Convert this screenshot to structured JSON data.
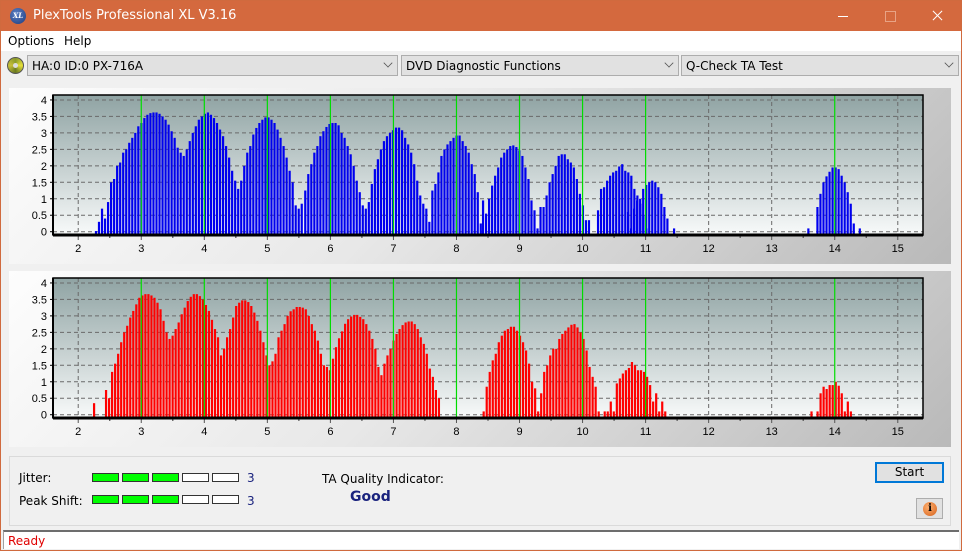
{
  "window": {
    "title": "PlexTools Professional XL V3.16",
    "icon": "xl-logo-icon"
  },
  "menu": {
    "items": [
      "Options",
      "Help"
    ]
  },
  "toolbar": {
    "drive": "HA:0 ID:0  PX-716A",
    "function_group": "DVD Diagnostic Functions",
    "test": "Q-Check TA Test"
  },
  "results": {
    "jitter_label": "Jitter:",
    "jitter_value": 3,
    "jitter_scale_max": 5,
    "peak_shift_label": "Peak Shift:",
    "peak_shift_value": 3,
    "peak_shift_scale_max": 5,
    "ta_label": "TA Quality Indicator:",
    "ta_value": "Good",
    "start_label": "Start",
    "info_label": "i"
  },
  "status": {
    "text": "Ready"
  },
  "colors": {
    "accent_title": "#d4693e",
    "series_top": "#0000ee",
    "series_bottom": "#ff0000",
    "marker_lines": "#00dd00",
    "meter_on": "#00ff00",
    "quality_text": "#1a237e",
    "status_text": "#e00000"
  },
  "chart_data": [
    {
      "type": "bar",
      "name": "land-ta-distribution",
      "xlim": [
        1.6,
        15.4
      ],
      "ylim": [
        -0.1,
        4.15
      ],
      "xticks": [
        2,
        3,
        4,
        5,
        6,
        7,
        8,
        9,
        10,
        11,
        12,
        13,
        14,
        15
      ],
      "yticks": [
        0,
        0.5,
        1,
        1.5,
        2,
        2.5,
        3,
        3.5,
        4
      ],
      "ytick_labels": [
        "0",
        "0.5",
        "1",
        "1.5",
        "2",
        "2.5",
        "3",
        "3.5",
        "4"
      ],
      "marker_lines_x": [
        3,
        4,
        5,
        6,
        7,
        8,
        9,
        10,
        11,
        14
      ],
      "grid": true,
      "color": "#0000ee",
      "peaks": [
        {
          "start": 2.28,
          "step": 0.048,
          "values": [
            0.02,
            0.3,
            0.7,
            0.4,
            0.9,
            1.5,
            1.6,
            2.0,
            2.1,
            2.4,
            2.5,
            2.7,
            2.85,
            3.0,
            3.2,
            3.3,
            3.45,
            3.55,
            3.6,
            3.62,
            3.62,
            3.58,
            3.5,
            3.4,
            3.25,
            3.05,
            2.85,
            2.55,
            2.4,
            2.3,
            2.5,
            2.75,
            3.0,
            3.2,
            3.4,
            3.5,
            3.58,
            3.62,
            3.55,
            3.45,
            3.3,
            3.1,
            2.9,
            2.6,
            2.25,
            1.85,
            1.55,
            1.3,
            1.55,
            2.0,
            2.4,
            2.6,
            2.95,
            3.15,
            3.3,
            3.4,
            3.47,
            3.47,
            3.4,
            3.3,
            3.1,
            2.85,
            2.6,
            2.25,
            1.85,
            1.5,
            0.8,
            0.7,
            0.85
          ]
        },
        {
          "start": 5.6,
          "step": 0.048,
          "values": [
            1.25,
            1.75,
            2.05,
            2.4,
            2.6,
            2.9,
            3.05,
            3.18,
            3.27,
            3.3,
            3.3,
            3.23,
            3.0,
            2.85,
            2.6,
            2.35,
            2.0,
            1.55,
            1.2,
            0.8,
            0.7,
            0.9,
            1.45,
            1.9,
            2.2,
            2.5,
            2.75,
            2.9,
            3.0,
            3.08,
            3.16,
            3.16,
            3.08,
            2.85,
            2.65,
            2.4,
            2.05,
            1.55,
            1.1,
            0.85,
            0.7,
            0.3,
            1.25,
            1.45,
            1.8,
            2.3,
            2.5,
            2.65,
            2.75,
            2.85,
            2.92,
            2.92,
            2.75,
            2.6,
            2.4,
            2.05,
            1.75,
            1.2,
            0.25
          ]
        },
        {
          "start": 8.42,
          "step": 0.048,
          "values": [
            0.95,
            0.55,
            1.0,
            1.4,
            1.7,
            1.95,
            2.25,
            2.4,
            2.5,
            2.6,
            2.62,
            2.57,
            2.47,
            2.3,
            1.95,
            1.6,
            0.95,
            0.65,
            0.1,
            0.75,
            0.75,
            1.1,
            1.5,
            1.75,
            2.0,
            2.3,
            2.35,
            2.35,
            2.2,
            2.1,
            1.95,
            1.6,
            1.15,
            0.8,
            0.35,
            0.35,
            0.0,
            0.0,
            0.65,
            1.3,
            1.35,
            1.55,
            1.7,
            1.8,
            1.85,
            1.98,
            2.05,
            1.85,
            1.8,
            1.7,
            1.3,
            1.1,
            0.85,
            0.5,
            0.1
          ]
        },
        {
          "start": 10.72,
          "step": 0.048,
          "values": [
            0.6,
            0.1,
            0.7,
            0.95,
            1.0,
            1.3,
            1.42,
            1.5,
            1.55,
            1.5,
            1.35,
            1.15,
            0.75,
            0.4
          ]
        },
        {
          "start": 11.45,
          "step": 0.048,
          "values": [
            0.1
          ]
        },
        {
          "start": 13.58,
          "step": 0.048,
          "values": [
            0.1,
            0.0,
            0.0,
            0.75,
            1.15,
            1.5,
            1.68,
            1.82,
            1.95,
            1.95,
            1.9,
            1.7,
            1.5,
            1.2,
            0.85,
            0.25,
            0.0,
            0.1
          ]
        }
      ]
    },
    {
      "type": "bar",
      "name": "pit-ta-distribution",
      "xlim": [
        1.6,
        15.4
      ],
      "ylim": [
        -0.1,
        4.15
      ],
      "xticks": [
        2,
        3,
        4,
        5,
        6,
        7,
        8,
        9,
        10,
        11,
        12,
        13,
        14,
        15
      ],
      "yticks": [
        0,
        0.5,
        1,
        1.5,
        2,
        2.5,
        3,
        3.5,
        4
      ],
      "ytick_labels": [
        "0",
        "0.5",
        "1",
        "1.5",
        "2",
        "2.5",
        "3",
        "3.5",
        "4"
      ],
      "marker_lines_x": [
        3,
        4,
        5,
        6,
        7,
        8,
        9,
        10,
        11,
        14
      ],
      "grid": true,
      "color": "#ff0000",
      "peaks": [
        {
          "start": 2.25,
          "step": 0.048,
          "values": [
            0.35
          ]
        },
        {
          "start": 2.44,
          "step": 0.048,
          "values": [
            0.75,
            0.5,
            1.3,
            1.55,
            1.85,
            2.2,
            2.5,
            2.7,
            2.95,
            3.15,
            3.35,
            3.55,
            3.62,
            3.66,
            3.66,
            3.62,
            3.55,
            3.4,
            3.2,
            2.85,
            2.5,
            2.3,
            2.4,
            2.6,
            2.8,
            3.05,
            3.25,
            3.45,
            3.58,
            3.66,
            3.66,
            3.6,
            3.5,
            3.33,
            3.15,
            2.88,
            2.6,
            2.35,
            1.8,
            2.0,
            2.35,
            2.6,
            2.95,
            3.3,
            3.4,
            3.47,
            3.47,
            3.42,
            3.3,
            3.1,
            2.85,
            2.55,
            2.2,
            1.8,
            1.5,
            1.62,
            1.85,
            2.35,
            2.55,
            2.75,
            3.0,
            3.14,
            3.2,
            3.27,
            3.27,
            3.25,
            3.2,
            3.0,
            2.75,
            2.55,
            2.25,
            1.85,
            1.5,
            1.45,
            1.35,
            1.7,
            2.05,
            2.32,
            2.53,
            2.76,
            2.9,
            2.98,
            3.03,
            3.03,
            2.97,
            2.9,
            2.75,
            2.55,
            2.3,
            2.0,
            1.45,
            1.2,
            1.55,
            1.8,
            2.0,
            2.25,
            2.45,
            2.6,
            2.72,
            2.8,
            2.83,
            2.83,
            2.75,
            2.6,
            2.35,
            2.15,
            1.85,
            1.4,
            1.15,
            0.75,
            0.5
          ]
        },
        {
          "start": 8.43,
          "step": 0.048,
          "values": [
            0.1,
            0.85,
            1.3,
            1.65,
            1.85,
            2.2,
            2.4,
            2.55,
            2.6,
            2.67,
            2.67,
            2.55,
            2.4,
            2.2,
            1.95,
            1.55,
            1.0,
            0.8,
            0.1,
            0.65,
            1.3,
            1.5,
            1.8,
            2.0,
            2.0,
            2.3,
            2.45,
            2.55,
            2.65,
            2.73,
            2.75,
            2.65,
            2.5,
            2.3,
            1.95,
            1.45,
            1.15,
            0.85,
            0.1,
            0.0,
            0.1,
            0.1,
            0.4,
            0.1,
            0.95,
            1.1,
            1.25,
            1.35,
            1.42,
            1.6,
            1.5,
            1.35,
            1.35,
            1.3,
            1.15,
            0.9,
            0.4,
            0.65,
            0.1,
            0.4,
            0.1
          ]
        },
        {
          "start": 13.63,
          "step": 0.048,
          "values": [
            0.1,
            0.0,
            0.1,
            0.65,
            0.85,
            0.78,
            0.9,
            0.9,
            1.0,
            0.88,
            0.65,
            0.1,
            0.4,
            0.1
          ]
        }
      ]
    }
  ]
}
